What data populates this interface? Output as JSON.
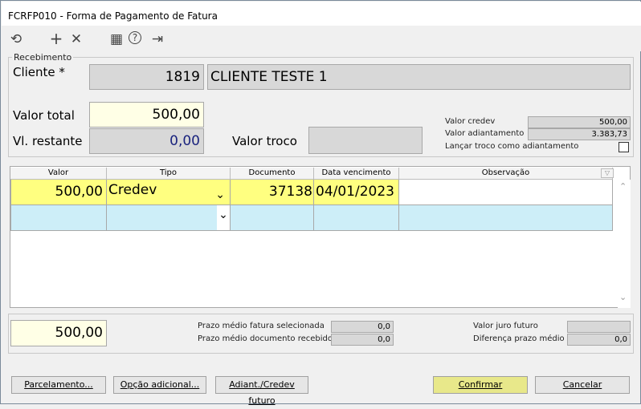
{
  "window": {
    "title": "FCRFP010 - Forma de Pagamento de Fatura"
  },
  "toolbar": {
    "icons": [
      "refresh-icon",
      "add-icon",
      "delete-icon",
      "calendar-icon",
      "help-icon",
      "exit-icon"
    ],
    "glyphs": {
      "refresh": "⟲",
      "add": "+",
      "delete": "✕",
      "calendar": "▦",
      "help": "?",
      "exit": "⇥"
    }
  },
  "recebimento": {
    "group_label": "Recebimento",
    "cliente_label": "Cliente *",
    "cliente_code": "1819",
    "cliente_name": "CLIENTE TESTE 1",
    "valor_total_label": "Valor total",
    "valor_total": "500,00",
    "vl_restante_label": "Vl. restante",
    "vl_restante": "0,00",
    "valor_troco_label": "Valor troco",
    "valor_troco": "",
    "valor_credev_label": "Valor credev",
    "valor_credev": "500,00",
    "valor_adiantamento_label": "Valor adiantamento",
    "valor_adiantamento": "3.383,73",
    "lancar_troco_label": "Lançar troco como adiantamento"
  },
  "grid": {
    "columns": [
      "Valor",
      "Tipo",
      "Documento",
      "Data vencimento",
      "Observação"
    ],
    "rows": [
      {
        "valor": "500,00",
        "tipo": "Credev",
        "documento": "37138",
        "data_vencimento": "04/01/2023",
        "observacao": ""
      },
      {
        "valor": "",
        "tipo": "",
        "documento": "",
        "data_vencimento": "",
        "observacao": ""
      }
    ],
    "dropdown_glyph": "⌄",
    "scroll_up": "⌃",
    "scroll_down": "⌄"
  },
  "footer": {
    "total": "500,00",
    "prazo_fatura_label": "Prazo médio fatura selecionada",
    "prazo_fatura": "0,0",
    "prazo_documento_label": "Prazo médio documento recebido",
    "prazo_documento": "0,0",
    "juro_futuro_label": "Valor juro futuro",
    "juro_futuro": "",
    "diferenca_prazo_label": "Diferença prazo médio",
    "diferenca_prazo": "0,0"
  },
  "buttons": {
    "parcelamento": "Parcelamento...",
    "opcao_adicional": "Opção adicional...",
    "adiant_credev": "Adiant./Credev futuro",
    "confirmar": "Confirmar",
    "cancelar": "Cancelar"
  },
  "colors": {
    "yellow_row": "#ffff80",
    "blue_row": "#cdeef8",
    "confirm": "#e8e88a"
  }
}
